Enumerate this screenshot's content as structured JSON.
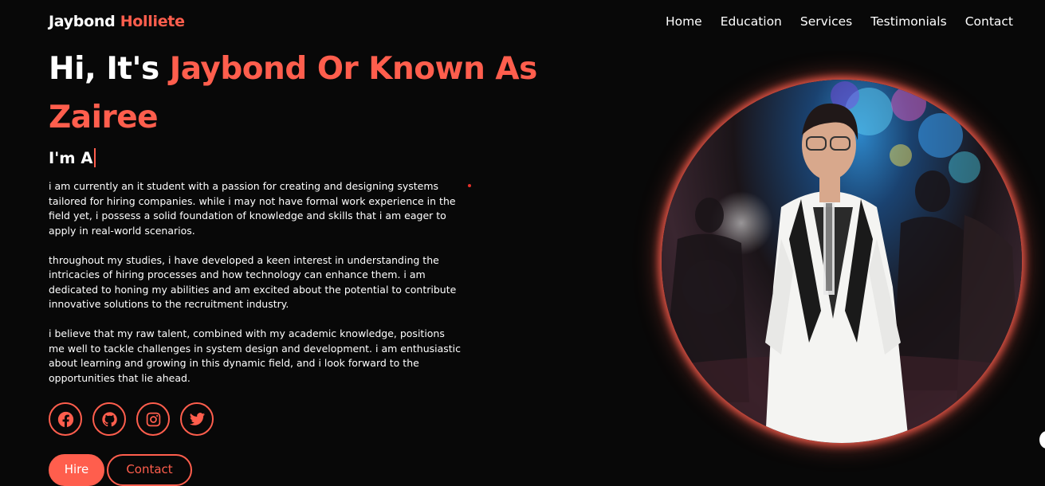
{
  "header": {
    "logo_first": "Jaybond",
    "logo_last": "Holliete",
    "nav": [
      "Home",
      "Education",
      "Services",
      "Testimonials",
      "Contact"
    ]
  },
  "hero": {
    "greeting": "Hi, It's",
    "name_highlight": "Jaybond Or Known As Zairee",
    "role_prefix": "I'm A",
    "bio": [
      "i am currently an it student with a passion for creating and designing systems tailored for hiring companies. while i may not have formal work experience in the field yet, i possess a solid foundation of knowledge and skills that i am eager to apply in real-world scenarios.",
      "throughout my studies, i have developed a keen interest in understanding the intricacies of hiring processes and how technology can enhance them. i am dedicated to honing my abilities and am excited about the potential to contribute innovative solutions to the recruitment industry.",
      "i believe that my raw talent, combined with my academic knowledge, positions me well to tackle challenges in system design and development. i am enthusiastic about learning and growing in this dynamic field, and i look forward to the opportunities that lie ahead."
    ],
    "socials": [
      "facebook-icon",
      "github-icon",
      "instagram-icon",
      "twitter-icon"
    ],
    "buttons": {
      "hire": "Hire",
      "contact": "Contact"
    }
  },
  "colors": {
    "accent": "#ff5e4d",
    "background": "#080808",
    "text": "#ffffff"
  }
}
